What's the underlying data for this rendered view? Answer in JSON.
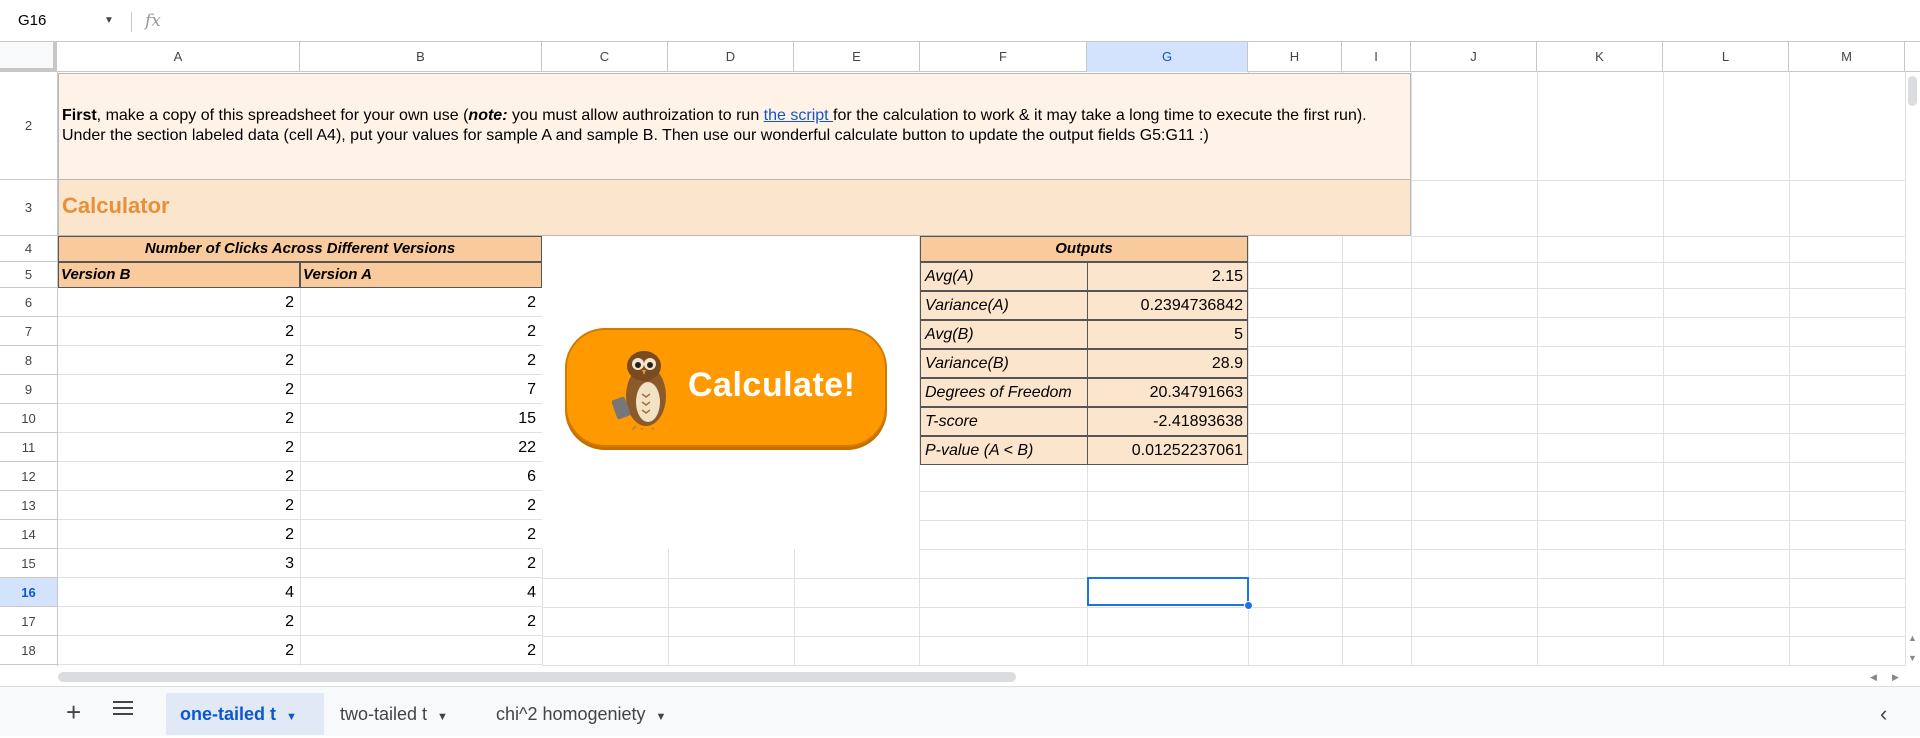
{
  "formula_bar": {
    "cell_ref": "G16",
    "fx_label": "fx",
    "formula": ""
  },
  "columns": [
    "A",
    "B",
    "C",
    "D",
    "E",
    "F",
    "G",
    "H",
    "I",
    "J",
    "K",
    "L",
    "M"
  ],
  "rows": [
    "2",
    "3",
    "4",
    "5",
    "6",
    "7",
    "8",
    "9",
    "10",
    "11",
    "12",
    "13",
    "14",
    "15",
    "16",
    "17",
    "18"
  ],
  "banner": {
    "first": "First",
    "part1": ", make a copy of this spreadsheet for your own use (",
    "note": "note:",
    "part2": " you must allow authroization to run ",
    "link": "the script ",
    "part3": "for the calculation to work & it may take a long time to execute the first run).",
    "line2": "Under the section labeled data (cell A4), put your values for sample A and sample B. Then use our wonderful calculate button to update the output fields G5:G11 :)"
  },
  "calculator_title": "Calculator",
  "data_table": {
    "title": "Number of Clicks Across Different Versions",
    "col_b_header": "Version B",
    "col_a_header": "Version A",
    "rows": [
      [
        "2",
        "2"
      ],
      [
        "2",
        "2"
      ],
      [
        "2",
        "2"
      ],
      [
        "2",
        "7"
      ],
      [
        "2",
        "15"
      ],
      [
        "2",
        "22"
      ],
      [
        "2",
        "6"
      ],
      [
        "2",
        "2"
      ],
      [
        "2",
        "2"
      ],
      [
        "3",
        "2"
      ],
      [
        "4",
        "4"
      ],
      [
        "2",
        "2"
      ],
      [
        "2",
        "2"
      ]
    ]
  },
  "button": {
    "label": "Calculate!"
  },
  "outputs": {
    "title": "Outputs",
    "rows": [
      {
        "label": "Avg(A)",
        "value": "2.15"
      },
      {
        "label": "Variance(A)",
        "value": "0.2394736842"
      },
      {
        "label": "Avg(B)",
        "value": "5"
      },
      {
        "label": "Variance(B)",
        "value": "28.9"
      },
      {
        "label": "Degrees of Freedom",
        "value": "20.34791663"
      },
      {
        "label": "T-score",
        "value": "-2.41893638"
      },
      {
        "label": "P-value (A < B)",
        "value": "0.01252237061"
      }
    ]
  },
  "sheet_tabs": [
    {
      "label": "one-tailed t",
      "active": true
    },
    {
      "label": "two-tailed t",
      "active": false
    },
    {
      "label": "chi^2 homogeniety",
      "active": false
    }
  ],
  "colors": {
    "accent": "#0b57d0",
    "header_fill": "#f9cb9c",
    "output_fill": "#fce5cd",
    "button": "#ff9900",
    "title_text": "#e69138"
  }
}
